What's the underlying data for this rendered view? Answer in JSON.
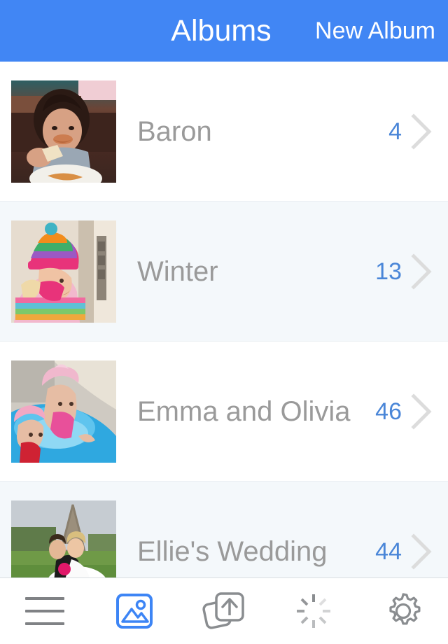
{
  "header": {
    "title": "Albums",
    "action_label": "New Album",
    "background_color": "#4186f4",
    "text_color": "#ffffff"
  },
  "list": {
    "row_background": "#ffffff",
    "row_alt_background": "#f4f8fb",
    "label_color": "#9a9a9a",
    "count_color": "#4a86d8",
    "chevron_color": "#dcdcdc",
    "chevron_icon": "chevron-right-icon",
    "albums": [
      {
        "name": "Baron",
        "count": "4",
        "thumbnail_alt": "Child with dark hair eating food at a table"
      },
      {
        "name": "Winter",
        "count": "13",
        "thumbnail_alt": "Girl in striped knit hat and scarf outdoors"
      },
      {
        "name": "Emma and Olivia",
        "count": "46",
        "thumbnail_alt": "Two girls in sun hats in a blue inflatable pool"
      },
      {
        "name": "Ellie's Wedding",
        "count": "44",
        "thumbnail_alt": "Bride and groom seated on grass near the Eiffel Tower"
      }
    ]
  },
  "toolbar": {
    "inactive_color": "#8a8d90",
    "active_color": "#3d85f5",
    "items": [
      {
        "icon": "menu-icon",
        "active": false
      },
      {
        "icon": "photos-icon",
        "active": true
      },
      {
        "icon": "upload-icon",
        "active": false
      },
      {
        "icon": "spinner-icon",
        "active": false
      },
      {
        "icon": "gear-icon",
        "active": false
      }
    ]
  }
}
